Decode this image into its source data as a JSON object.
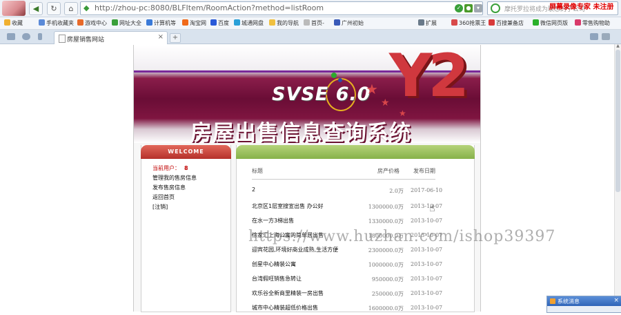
{
  "browser": {
    "url": "http://zhou-pc:8080/BLFItem/RoomAction?method=listRoom",
    "search_placeholder": "摩托罗拉将成为联想的子公司",
    "watermark_top": "屏幕录像专家 未注册",
    "bookmarks": [
      "收藏",
      "手机收藏夹",
      "游戏中心",
      "网址大全",
      "计算机等",
      "淘宝网",
      "百度",
      "城通网盘",
      "我的导航",
      "首页-",
      "广州初始",
      "扩展",
      "360抢票王",
      "百搜兼备店",
      "微信网页版",
      "零售购物助"
    ],
    "tab_title": "房屋销售网站",
    "tab_close": "×",
    "new_tab": "+"
  },
  "page": {
    "banner": {
      "logo_text": "SVSE 6.0",
      "title": "房屋出售信息查询系统",
      "brand_mark": "Y2"
    },
    "sidebar": {
      "header": "WELCOME",
      "user_label": "当前用户：",
      "user_value": "8",
      "links": [
        "管理我的售房信息",
        "发布售房信息",
        "返回首页",
        "[注销]"
      ]
    },
    "listing": {
      "columns": [
        "标题",
        "房产价格",
        "发布日期"
      ],
      "rows": [
        {
          "title": "2",
          "price": "2.0万",
          "date": "2017-06-10"
        },
        {
          "title": "北京区1层室搜宣出售 办公好",
          "price": "1300000.0万",
          "date": "2013-10-07"
        },
        {
          "title": "在水一方3梯出售",
          "price": "1330000.0万",
          "date": "2013-10-07"
        },
        {
          "title": "徐家汇上海公寓的简单居出售",
          "price": "1800000.0万",
          "date": "2013-10-07"
        },
        {
          "title": "迎宾花园,环境好商业成熟,生活方便",
          "price": "2300000.0万",
          "date": "2013-10-07"
        },
        {
          "title": "创星中心精装公寓",
          "price": "1000000.0万",
          "date": "2013-10-07"
        },
        {
          "title": "台湾假旺销售急转让",
          "price": "950000.0万",
          "date": "2013-10-07"
        },
        {
          "title": "欢乐谷全新商里精装一房出售",
          "price": "250000.0万",
          "date": "2013-10-07"
        },
        {
          "title": "城市中心精装超低价格出售",
          "price": "1600000.0万",
          "date": "2013-10-07"
        }
      ]
    },
    "watermark_center": "https://www.huzhan.com/ishop39397"
  },
  "popup": {
    "title": "系统消息",
    "close": "×"
  },
  "colors": {
    "banner_maroon": "#6a0d36",
    "welcome_red": "#b5302a",
    "header_green": "#86b14a",
    "user_red": "#c00000"
  }
}
